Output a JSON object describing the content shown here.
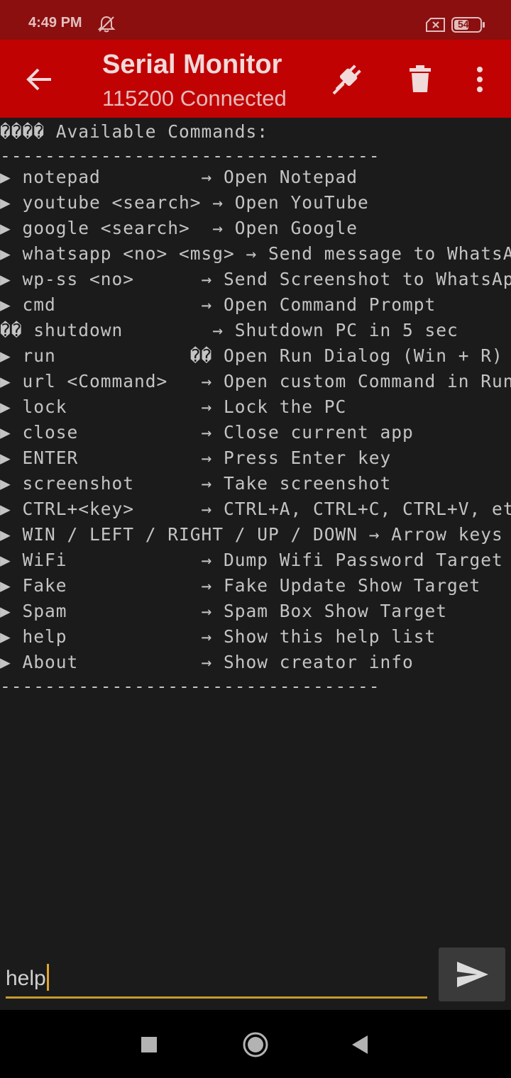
{
  "status_bar": {
    "time": "4:49 PM",
    "battery": "54",
    "icons": [
      "notifications-off-icon",
      "sim-x-icon",
      "battery-icon"
    ]
  },
  "app_bar": {
    "title": "Serial Monitor",
    "subtitle": "115200 Connected",
    "icons": [
      "back-arrow-icon",
      "disconnect-plug-icon",
      "trash-icon",
      "more-vert-icon"
    ]
  },
  "console": {
    "lines": [
      "���� Available Commands:",
      "----------------------------------",
      "▶ notepad         → Open Notepad",
      "▶ youtube <search> → Open YouTube",
      "▶ google <search>  → Open Google",
      "▶ whatsapp <no> <msg> → Send message to WhatsApp",
      "▶ wp-ss <no>      → Send Screenshot to WhatsApp",
      "▶ cmd             → Open Command Prompt",
      "�� shutdown        → Shutdown PC in 5 sec",
      "▶ run            �� Open Run Dialog (Win + R)",
      "▶ url <Command>   → Open custom Command in Run",
      "▶ lock            → Lock the PC",
      "▶ close           → Close current app",
      "▶ ENTER           → Press Enter key",
      "▶ screenshot      → Take screenshot",
      "▶ CTRL+<key>      → CTRL+A, CTRL+C, CTRL+V, etc",
      "▶ WIN / LEFT / RIGHT / UP / DOWN → Arrow keys",
      "▶ WiFi            → Dump Wifi Password Target",
      "▶ Fake            → Fake Update Show Target",
      "▶ Spam            → Spam Box Show Target",
      "▶ help            → Show this help list",
      "▶ About           → Show creator info",
      "----------------------------------"
    ]
  },
  "input": {
    "value": "help"
  },
  "send": {
    "icon": "send-icon"
  },
  "nav_bar": {
    "icons": [
      "recents-square-icon",
      "home-circle-icon",
      "back-triangle-icon"
    ]
  },
  "colors": {
    "status_bar": "#8b0f0f",
    "app_bar": "#c10202",
    "background": "#1b1b1b",
    "console_text": "#c4c4c4",
    "input_underline": "#c79a2e"
  }
}
